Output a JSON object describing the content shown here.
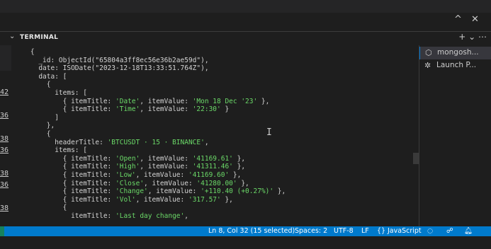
{
  "panel": {
    "terminal_tab": "TERMINAL",
    "top_actions": [
      "^",
      "✕"
    ],
    "terminal_actions": "+ ⌄ ⋯"
  },
  "left_gutter": {
    "line_numbers": [
      "42",
      "36",
      "38",
      "36",
      "38",
      "36",
      "38"
    ]
  },
  "terminal_lines": [
    {
      "segments": [
        {
          "t": "    {"
        }
      ]
    },
    {
      "segments": [
        {
          "t": "      _id: ObjectId(\"65804a3ff8ec56e36b2ae59d\"),"
        }
      ]
    },
    {
      "segments": [
        {
          "t": "      date: ISODate(\"2023-12-18T13:33:51.764Z\"),"
        }
      ]
    },
    {
      "segments": [
        {
          "t": "      data: ["
        }
      ]
    },
    {
      "segments": [
        {
          "t": "        {"
        }
      ]
    },
    {
      "segments": [
        {
          "t": "          items: ["
        }
      ]
    },
    {
      "segments": [
        {
          "t": "            { itemTitle: "
        },
        {
          "t": "'Date'",
          "s": 1
        },
        {
          "t": ", itemValue: "
        },
        {
          "t": "'Mon 18 Dec '23'",
          "s": 1
        },
        {
          "t": " },"
        }
      ]
    },
    {
      "segments": [
        {
          "t": "            { itemTitle: "
        },
        {
          "t": "'Time'",
          "s": 1
        },
        {
          "t": ", itemValue: "
        },
        {
          "t": "'22:30'",
          "s": 1
        },
        {
          "t": " }"
        }
      ]
    },
    {
      "segments": [
        {
          "t": "          ]"
        }
      ]
    },
    {
      "segments": [
        {
          "t": "        },"
        }
      ]
    },
    {
      "segments": [
        {
          "t": "        {"
        }
      ]
    },
    {
      "segments": [
        {
          "t": "          headerTitle: "
        },
        {
          "t": "'BTCUSDT · 15 · BINANCE'",
          "s": 1
        },
        {
          "t": ","
        }
      ]
    },
    {
      "segments": [
        {
          "t": "          items: ["
        }
      ]
    },
    {
      "segments": [
        {
          "t": "            { itemTitle: "
        },
        {
          "t": "'Open'",
          "s": 1
        },
        {
          "t": ", itemValue: "
        },
        {
          "t": "'41169.61'",
          "s": 1
        },
        {
          "t": " },"
        }
      ]
    },
    {
      "segments": [
        {
          "t": "            { itemTitle: "
        },
        {
          "t": "'High'",
          "s": 1
        },
        {
          "t": ", itemValue: "
        },
        {
          "t": "'41311.46'",
          "s": 1
        },
        {
          "t": " },"
        }
      ]
    },
    {
      "segments": [
        {
          "t": "            { itemTitle: "
        },
        {
          "t": "'Low'",
          "s": 1
        },
        {
          "t": ", itemValue: "
        },
        {
          "t": "'41169.60'",
          "s": 1
        },
        {
          "t": " },"
        }
      ]
    },
    {
      "segments": [
        {
          "t": "            { itemTitle: "
        },
        {
          "t": "'Close'",
          "s": 1
        },
        {
          "t": ", itemValue: "
        },
        {
          "t": "'41280.00'",
          "s": 1
        },
        {
          "t": " },"
        }
      ]
    },
    {
      "segments": [
        {
          "t": "            { itemTitle: "
        },
        {
          "t": "'Change'",
          "s": 1
        },
        {
          "t": ", itemValue: "
        },
        {
          "t": "'+110.40 (+0.27%)'",
          "s": 1
        },
        {
          "t": " },"
        }
      ]
    },
    {
      "segments": [
        {
          "t": "            { itemTitle: "
        },
        {
          "t": "'Vol'",
          "s": 1
        },
        {
          "t": ", itemValue: "
        },
        {
          "t": "'317.57'",
          "s": 1
        },
        {
          "t": " },"
        }
      ]
    },
    {
      "segments": [
        {
          "t": "            {"
        }
      ]
    },
    {
      "segments": [
        {
          "t": "              itemTitle: "
        },
        {
          "t": "'Last day change'",
          "s": 1
        },
        {
          "t": ","
        }
      ]
    }
  ],
  "terminal_list": [
    {
      "icon": "mongodb-shell-icon",
      "glyph": "⬡",
      "label": "mongosh...",
      "active": true
    },
    {
      "icon": "debug-launch-icon",
      "glyph": "✲",
      "label": "Launch P...",
      "active": false
    }
  ],
  "status": {
    "position": "Ln 8, Col 32 (15 selected)",
    "spaces": "Spaces: 2",
    "encoding": "UTF-8",
    "eol": "LF",
    "language": "JavaScript",
    "language_glyph": "{}"
  },
  "colors": {
    "status_bar": "#007acc",
    "string": "#6bd968",
    "background": "#1e1e1e"
  }
}
